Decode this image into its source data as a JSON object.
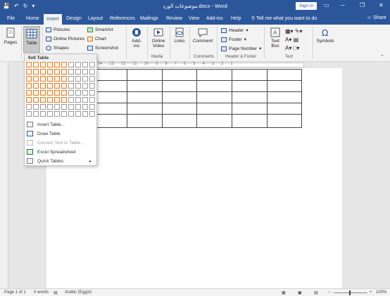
{
  "titlebar": {
    "title": "موضوعات الورد.docx - Word",
    "signin": "Sign in",
    "qat": [
      "save-icon",
      "undo-icon",
      "redo-icon",
      "customize-icon"
    ],
    "window_controls": [
      "─",
      "❐",
      "✕"
    ],
    "ribbon_display_icon": "▭"
  },
  "tabs": [
    {
      "label": "File"
    },
    {
      "label": "Home"
    },
    {
      "label": "Insert"
    },
    {
      "label": "Design"
    },
    {
      "label": "Layout"
    },
    {
      "label": "References"
    },
    {
      "label": "Mailings"
    },
    {
      "label": "Review"
    },
    {
      "label": "View"
    },
    {
      "label": "Add-ins"
    },
    {
      "label": "Help"
    }
  ],
  "tellme": "Tell me what you want to do",
  "share": "Share",
  "ribbon": {
    "pages": "Pages",
    "table": "Table",
    "pictures": "Pictures",
    "online_pictures": "Online Pictures",
    "shapes": "Shapes",
    "smartart": "SmartArt",
    "chart": "Chart",
    "screenshot": "Screenshot",
    "addins_line1": "Add-",
    "addins_line2": "ins",
    "online_video_line1": "Online",
    "online_video_line2": "Video",
    "links": "Links",
    "comment": "Comment",
    "header": "Header",
    "footer": "Footer",
    "page_number": "Page Number",
    "textbox_line1": "Text",
    "textbox_line2": "Box",
    "symbols": "Symbols",
    "group_media": "Media",
    "group_comments": "Comments",
    "group_header_footer": "Header & Footer",
    "group_text": "Text"
  },
  "dropdown": {
    "header": "6x6 Table",
    "grid_cols": 10,
    "grid_rows": 8,
    "selected_cols": 6,
    "selected_rows": 6,
    "items": [
      {
        "label": "Insert Table..."
      },
      {
        "label": "Draw Table"
      },
      {
        "label": "Convert Text to Table..."
      },
      {
        "label": "Excel Spreadsheet"
      },
      {
        "label": "Quick Tables"
      }
    ]
  },
  "ruler_numbers": "14 · · 13 · · 12 · · 11 · · 10 · · 9 · · 8 · · 7 · · 6 · · 5 · · 4 · · 3 · · 2 · · 1 ·",
  "status": {
    "page": "Page 1 of 1",
    "words": "0 words",
    "language": "Arabic (Egypt)",
    "zoom": "100%"
  },
  "colors": {
    "accent": "#2b579a",
    "grid_highlight": "#e67e22"
  }
}
